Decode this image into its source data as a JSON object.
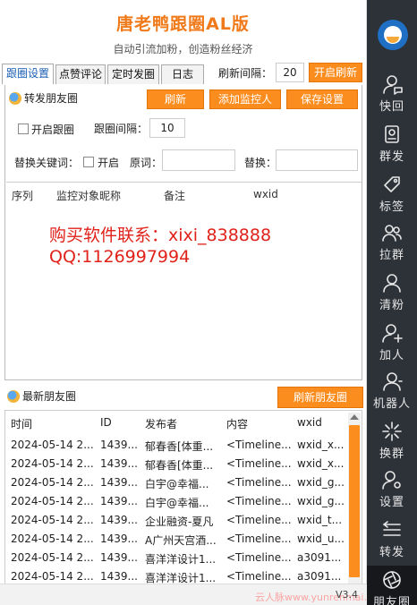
{
  "header": {
    "title": "唐老鸭跟圈AL版",
    "subtitle": "自动引流加粉，创造粉丝经济"
  },
  "tabs": [
    {
      "label": "跟圈设置",
      "active": true
    },
    {
      "label": "点赞评论",
      "active": false
    },
    {
      "label": "定时发圈",
      "active": false
    },
    {
      "label": "日志",
      "active": false
    }
  ],
  "refresh": {
    "label": "刷新间隔：",
    "value": "20",
    "start_label": "开启刷新"
  },
  "forward": {
    "title": "转发朋友圈",
    "refresh_label": "刷新",
    "add_monitor_label": "添加监控人",
    "save_label": "保存设置",
    "enable_label": "开启跟圈",
    "interval_label": "跟圈间隔：",
    "interval_value": "10",
    "replace_kw_label": "替换关键词：",
    "enable_replace_label": "开启",
    "original_label": "原词：",
    "replace_label": "替换：",
    "original_value": "",
    "replace_value": "",
    "columns": [
      "序列",
      "监控对象昵称",
      "备注",
      "wxid"
    ],
    "ad_line1": "购买软件联系：xixi_838888",
    "ad_line2": "QQ:1126997994"
  },
  "moments": {
    "title": "最新朋友圈",
    "refresh_label": "刷新朋友圈",
    "columns": [
      "时间",
      "ID",
      "发布者",
      "内容",
      "wxid"
    ],
    "rows": [
      [
        "2024-05-14 2...",
        "1439...",
        "郁春香[体重...",
        "<Timeline...",
        "wxid_x..."
      ],
      [
        "2024-05-14 2...",
        "1439...",
        "郁春香[体重...",
        "<Timeline...",
        "wxid_x..."
      ],
      [
        "2024-05-14 2...",
        "1439...",
        "白宇@幸福...",
        "<Timeline...",
        "wxid_g..."
      ],
      [
        "2024-05-14 2...",
        "1439...",
        "白宇@幸福...",
        "<Timeline...",
        "wxid_g..."
      ],
      [
        "2024-05-14 2...",
        "1439...",
        "企业融资-夏凡",
        "<Timeline...",
        "wxid_t..."
      ],
      [
        "2024-05-14 2...",
        "1439...",
        "A广州天宫酒...",
        "<Timeline...",
        "wxid_u..."
      ],
      [
        "2024-05-14 2...",
        "1439...",
        "喜洋洋设计1...",
        "<Timeline...",
        "a3091..."
      ],
      [
        "2024-05-14 2...",
        "1439...",
        "喜洋洋设计1...",
        "<Timeline...",
        "a3091..."
      ]
    ]
  },
  "footer": {
    "watermark": "云人脉www.yunrenmai.com",
    "version": "V3.4"
  },
  "sidebar": {
    "items": [
      {
        "label": "快回",
        "icon": "user-chat-icon"
      },
      {
        "label": "群发",
        "icon": "broadcast-icon"
      },
      {
        "label": "标签",
        "icon": "tag-icon"
      },
      {
        "label": "拉群",
        "icon": "group-icon"
      },
      {
        "label": "清粉",
        "icon": "user-clean-icon"
      },
      {
        "label": "加人",
        "icon": "add-user-icon"
      },
      {
        "label": "机器人",
        "icon": "robot-icon"
      },
      {
        "label": "换群",
        "icon": "sparkle-icon"
      },
      {
        "label": "设置",
        "icon": "user-gear-icon"
      },
      {
        "label": "转发",
        "icon": "forward-icon"
      },
      {
        "label": "朋友圈",
        "icon": "aperture-icon"
      }
    ]
  },
  "colors": {
    "accent": "#fb8c1e",
    "title": "#f07a1a",
    "sidebar_bg": "#2d3138",
    "ad_text": "#e0221a"
  }
}
